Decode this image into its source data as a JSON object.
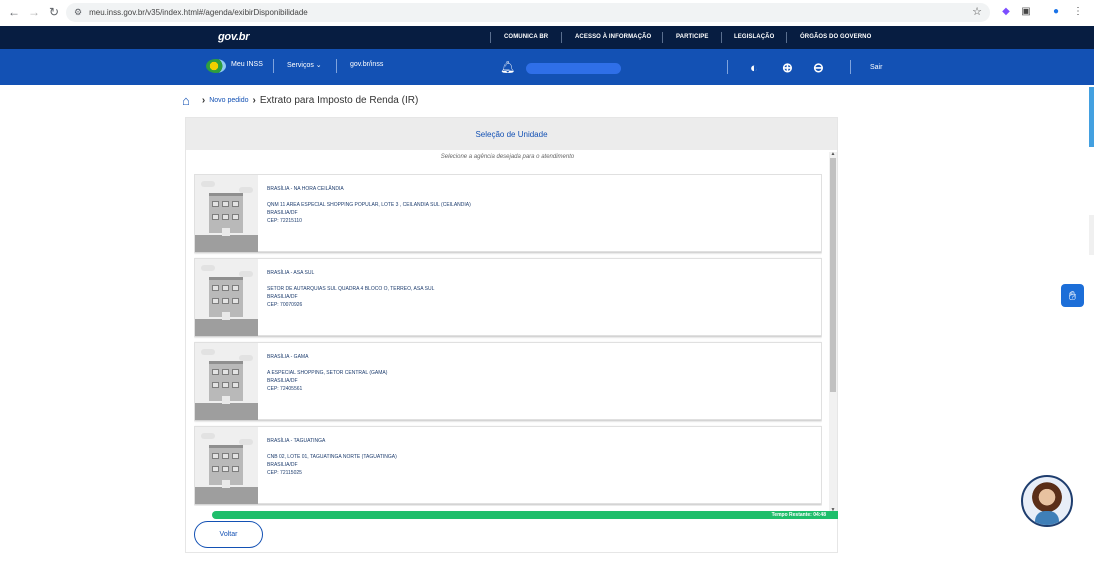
{
  "browser": {
    "url": "meu.inss.gov.br/v35/index.html#/agenda/exibirDisponibilidade"
  },
  "govbar": {
    "logo": "gov.br",
    "links": [
      "COMUNICA BR",
      "ACESSO À INFORMAÇÃO",
      "PARTICIPE",
      "LEGISLAÇÃO",
      "ÓRGÃOS DO GOVERNO"
    ]
  },
  "header": {
    "meu_inss": "Meu INSS",
    "servicos": "Serviços",
    "govbr_inss": "gov.br/inss",
    "sair": "Sair"
  },
  "breadcrumb": {
    "link": "Novo pedido",
    "current": "Extrato para Imposto de Renda (IR)"
  },
  "panel": {
    "title": "Seleção de Unidade",
    "subtitle": "Selecione a agência desejada para o atendimento"
  },
  "units": [
    {
      "name": "BRASÍLIA - NA HORA CEILÂNDIA",
      "address": "QNM 11 AREA ESPECIAL SHOPPING POPULAR, LOTE 3 , CEILANDIA SUL (CEILANDIA)",
      "city": "BRASILIA/DF",
      "cep": "CEP: 72215110"
    },
    {
      "name": "BRASÍLIA - ASA SUL",
      "address": "SETOR DE AUTARQUIAS SUL QUADRA 4 BLOCO O, TERREO, ASA SUL",
      "city": "BRASILIA/DF",
      "cep": "CEP: 70070926"
    },
    {
      "name": "BRASÍLIA - GAMA",
      "address": "A ESPECIAL SHOPPING, SETOR CENTRAL (GAMA)",
      "city": "BRASILIA/DF",
      "cep": "CEP: 72405561"
    },
    {
      "name": "BRASÍLIA - TAGUATINGA",
      "address": "CNB 02, LOTE 01, TAGUATINGA NORTE (TAGUATINGA)",
      "city": "BRASILIA/DF",
      "cep": "CEP: 72115025"
    }
  ],
  "timer": "Tempo Restante: 04:48",
  "back_label": "Voltar",
  "colors": {
    "gov_dark": "#071d41",
    "inss_blue": "#1351b4",
    "timer_green": "#1fbe6b"
  }
}
